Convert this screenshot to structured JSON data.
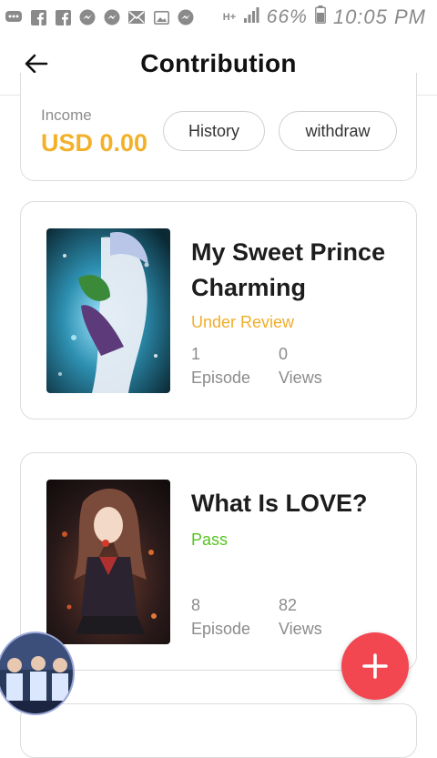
{
  "status_bar": {
    "left_icons": [
      "messaging-icon",
      "facebook-icon",
      "facebook-icon",
      "messenger-icon",
      "messenger-icon",
      "mail-icon",
      "gallery-icon",
      "messenger-icon"
    ],
    "network": "H+",
    "battery": "66%",
    "time": "10:05 PM"
  },
  "header": {
    "title": "Contribution"
  },
  "income": {
    "label": "Income",
    "value": "USD 0.00",
    "history_label": "History",
    "withdraw_label": "withdraw"
  },
  "stories": [
    {
      "title": "My Sweet Prince Charming",
      "status": "Under Review",
      "status_color": "#f0ad2d",
      "episodes": "1",
      "episodes_label": "Episode",
      "views": "0",
      "views_label": "Views"
    },
    {
      "title": "What Is LOVE?",
      "status": "Pass",
      "status_color": "#58c322",
      "episodes": "8",
      "episodes_label": "Episode",
      "views": "82",
      "views_label": "Views"
    }
  ],
  "colors": {
    "income_accent": "#f3b12b",
    "fab": "#f24651"
  },
  "fab": {
    "icon": "plus-icon"
  }
}
